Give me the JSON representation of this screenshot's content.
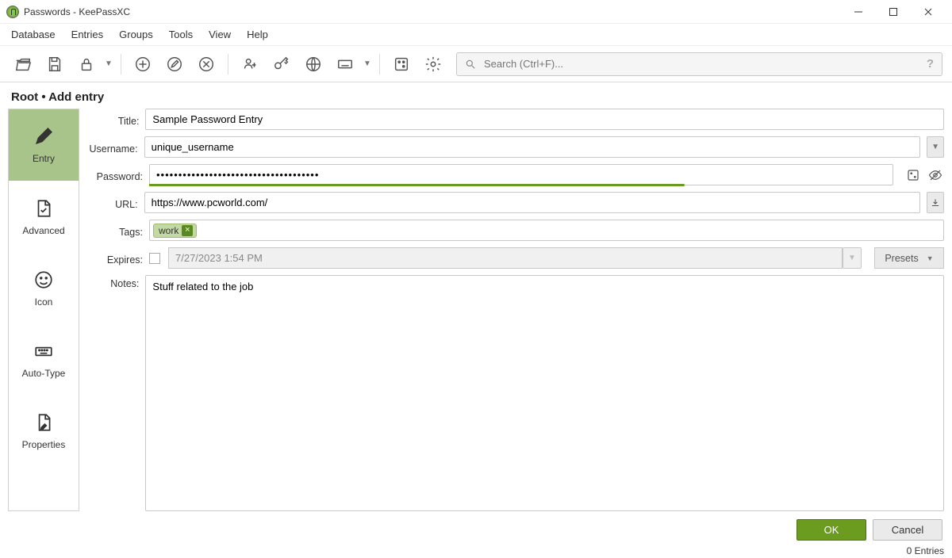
{
  "window": {
    "title": "Passwords - KeePassXC"
  },
  "menu": {
    "items": [
      "Database",
      "Entries",
      "Groups",
      "Tools",
      "View",
      "Help"
    ]
  },
  "search": {
    "placeholder": "Search (Ctrl+F)..."
  },
  "breadcrumb": "Root • Add entry",
  "sidetabs": {
    "items": [
      {
        "key": "entry",
        "label": "Entry"
      },
      {
        "key": "advanced",
        "label": "Advanced"
      },
      {
        "key": "icon",
        "label": "Icon"
      },
      {
        "key": "autotype",
        "label": "Auto-Type"
      },
      {
        "key": "properties",
        "label": "Properties"
      }
    ]
  },
  "labels": {
    "title": "Title:",
    "username": "Username:",
    "password": "Password:",
    "url": "URL:",
    "tags": "Tags:",
    "expires": "Expires:",
    "notes": "Notes:"
  },
  "form": {
    "title": "Sample Password Entry",
    "username": "unique_username",
    "password": "•••••••••••••••••••••••••••••••••••••",
    "url": "https://www.pcworld.com/",
    "tags": [
      "work"
    ],
    "expires_enabled": false,
    "expires": "7/27/2023 1:54 PM",
    "notes": "Stuff related to the job"
  },
  "buttons": {
    "presets": "Presets",
    "ok": "OK",
    "cancel": "Cancel"
  },
  "status": "0 Entries"
}
